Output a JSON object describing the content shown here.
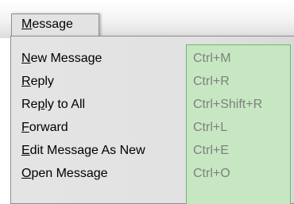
{
  "menu": {
    "title": "Message",
    "items": [
      {
        "pre": "",
        "mn": "N",
        "post": "ew Message",
        "shortcut": "Ctrl+M"
      },
      {
        "pre": "",
        "mn": "R",
        "post": "eply",
        "shortcut": "Ctrl+R"
      },
      {
        "pre": "Re",
        "mn": "p",
        "post": "ly to All",
        "shortcut": "Ctrl+Shift+R"
      },
      {
        "pre": "",
        "mn": "F",
        "post": "orward",
        "shortcut": "Ctrl+L"
      },
      {
        "pre": "",
        "mn": "E",
        "post": "dit Message As New",
        "shortcut": "Ctrl+E"
      },
      {
        "pre": "",
        "mn": "O",
        "post": "pen Message",
        "shortcut": "Ctrl+O"
      }
    ]
  },
  "colors": {
    "shortcut_highlight": "#c7e7c2",
    "shortcut_border": "#6bb76b",
    "shortcut_text": "#7f7f7f",
    "menu_background": "#e4e4e4"
  }
}
